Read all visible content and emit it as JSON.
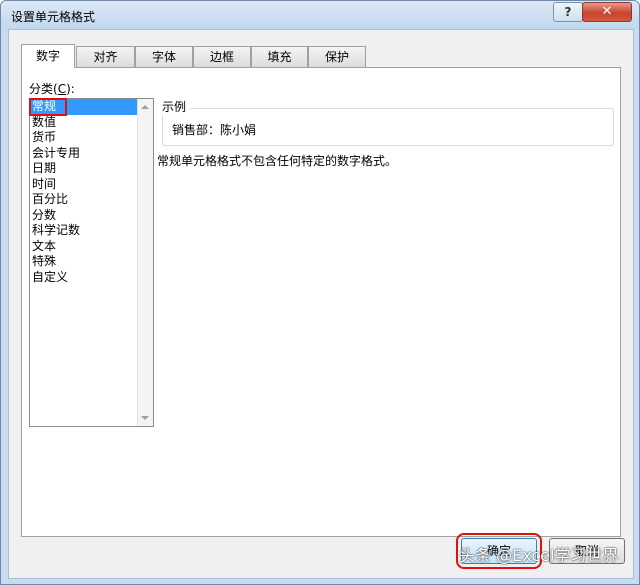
{
  "window": {
    "title": "设置单元格格式",
    "help_label": "?",
    "close_label": "✕"
  },
  "tabs": [
    {
      "label": "数字"
    },
    {
      "label": "对齐"
    },
    {
      "label": "字体"
    },
    {
      "label": "边框"
    },
    {
      "label": "填充"
    },
    {
      "label": "保护"
    }
  ],
  "category": {
    "label_prefix": "分类(",
    "label_key": "C",
    "label_suffix": "):",
    "items": [
      {
        "label": "常规"
      },
      {
        "label": "数值"
      },
      {
        "label": "货币"
      },
      {
        "label": "会计专用"
      },
      {
        "label": "日期"
      },
      {
        "label": "时间"
      },
      {
        "label": "百分比"
      },
      {
        "label": "分数"
      },
      {
        "label": "科学记数"
      },
      {
        "label": "文本"
      },
      {
        "label": "特殊"
      },
      {
        "label": "自定义"
      }
    ],
    "selected": "常规"
  },
  "sample": {
    "legend": "示例",
    "value": "销售部：陈小娟"
  },
  "description": "常规单元格格式不包含任何特定的数字格式。",
  "buttons": {
    "ok": "确定",
    "cancel": "取消"
  },
  "watermark": "头条 @Excel学习世界",
  "colors": {
    "selection": "#3399ff",
    "highlight": "#e01010"
  }
}
